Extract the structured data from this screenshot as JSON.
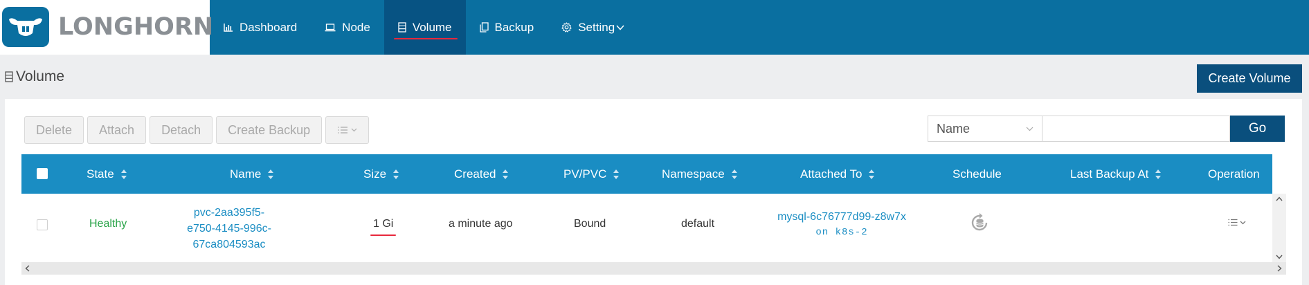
{
  "brand": {
    "name": "LONGHORN"
  },
  "nav": {
    "dashboard": "Dashboard",
    "node": "Node",
    "volume": "Volume",
    "backup": "Backup",
    "setting": "Setting"
  },
  "page": {
    "title": "Volume",
    "create_label": "Create Volume"
  },
  "toolbar": {
    "delete": "Delete",
    "attach": "Attach",
    "detach": "Detach",
    "create_backup": "Create Backup"
  },
  "search": {
    "field": "Name",
    "value": "",
    "go": "Go"
  },
  "table": {
    "headers": {
      "state": "State",
      "name": "Name",
      "size": "Size",
      "created": "Created",
      "pvpvc": "PV/PVC",
      "namespace": "Namespace",
      "attached": "Attached To",
      "schedule": "Schedule",
      "last_backup": "Last Backup At",
      "operation": "Operation"
    },
    "rows": [
      {
        "state": "Healthy",
        "name_line1": "pvc-2aa395f5-",
        "name_line2": "e750-4145-996c-",
        "name_line3": "67ca804593ac",
        "size": "1 Gi",
        "created": "a minute ago",
        "pvpvc": "Bound",
        "namespace": "default",
        "attached_to": "mysql-6c76777d99-z8w7x",
        "attached_node": "on k8s-2",
        "last_backup": ""
      }
    ]
  },
  "colors": {
    "header": "#0a6fa0",
    "nav_active": "#075383",
    "accent_red": "#e8283c",
    "table_header": "#1a8dc3",
    "primary_button": "#0a4f7d",
    "healthy": "#27a347"
  },
  "icons": {
    "logo": "longhorn-logo",
    "dashboard": "bar-chart-icon",
    "node": "laptop-icon",
    "volume": "database-list-icon",
    "backup": "copy-icon",
    "setting": "gear-icon",
    "schedule": "recurring-backup-icon",
    "operation": "list-menu-icon"
  }
}
